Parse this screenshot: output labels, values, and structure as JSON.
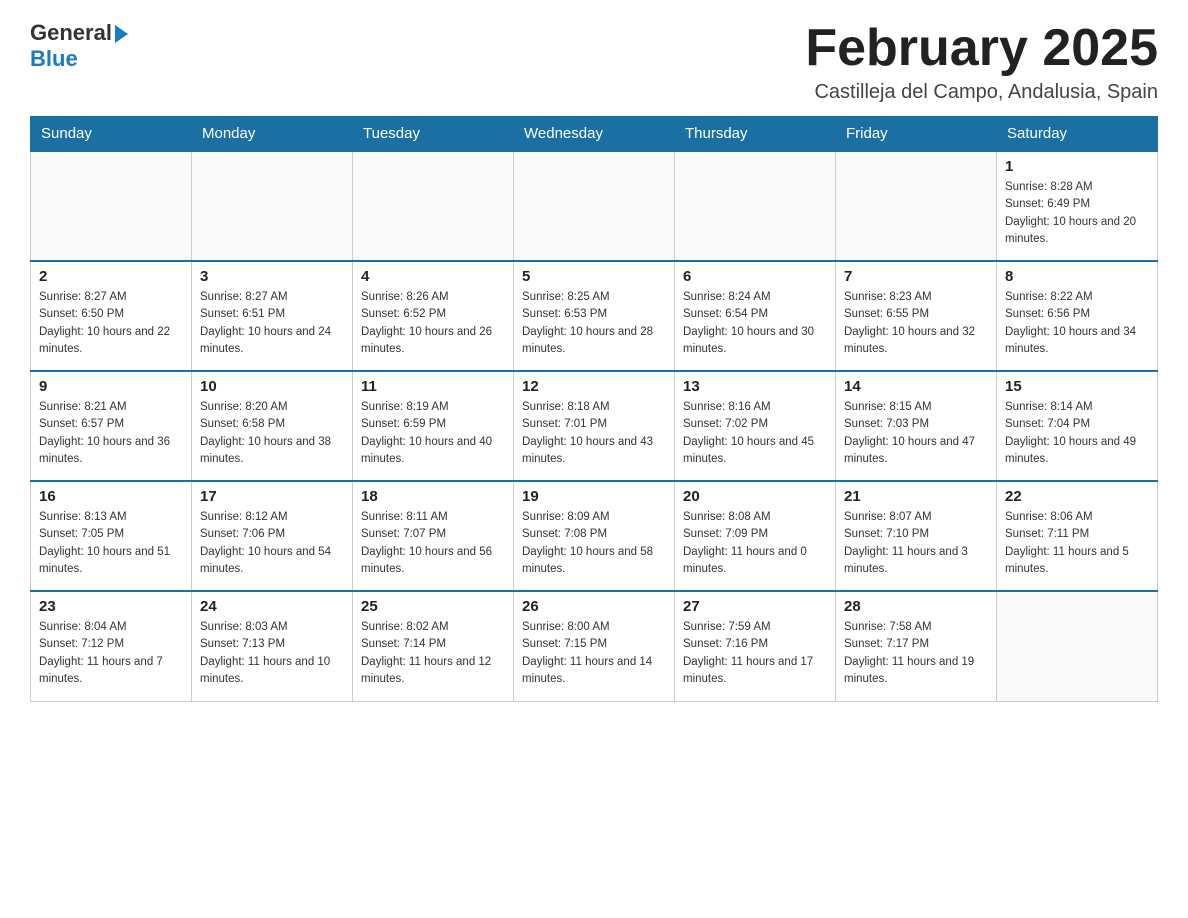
{
  "header": {
    "logo_general": "General",
    "logo_blue": "Blue",
    "month_title": "February 2025",
    "location": "Castilleja del Campo, Andalusia, Spain"
  },
  "days_of_week": [
    "Sunday",
    "Monday",
    "Tuesday",
    "Wednesday",
    "Thursday",
    "Friday",
    "Saturday"
  ],
  "weeks": [
    [
      {
        "day": "",
        "info": ""
      },
      {
        "day": "",
        "info": ""
      },
      {
        "day": "",
        "info": ""
      },
      {
        "day": "",
        "info": ""
      },
      {
        "day": "",
        "info": ""
      },
      {
        "day": "",
        "info": ""
      },
      {
        "day": "1",
        "info": "Sunrise: 8:28 AM\nSunset: 6:49 PM\nDaylight: 10 hours and 20 minutes."
      }
    ],
    [
      {
        "day": "2",
        "info": "Sunrise: 8:27 AM\nSunset: 6:50 PM\nDaylight: 10 hours and 22 minutes."
      },
      {
        "day": "3",
        "info": "Sunrise: 8:27 AM\nSunset: 6:51 PM\nDaylight: 10 hours and 24 minutes."
      },
      {
        "day": "4",
        "info": "Sunrise: 8:26 AM\nSunset: 6:52 PM\nDaylight: 10 hours and 26 minutes."
      },
      {
        "day": "5",
        "info": "Sunrise: 8:25 AM\nSunset: 6:53 PM\nDaylight: 10 hours and 28 minutes."
      },
      {
        "day": "6",
        "info": "Sunrise: 8:24 AM\nSunset: 6:54 PM\nDaylight: 10 hours and 30 minutes."
      },
      {
        "day": "7",
        "info": "Sunrise: 8:23 AM\nSunset: 6:55 PM\nDaylight: 10 hours and 32 minutes."
      },
      {
        "day": "8",
        "info": "Sunrise: 8:22 AM\nSunset: 6:56 PM\nDaylight: 10 hours and 34 minutes."
      }
    ],
    [
      {
        "day": "9",
        "info": "Sunrise: 8:21 AM\nSunset: 6:57 PM\nDaylight: 10 hours and 36 minutes."
      },
      {
        "day": "10",
        "info": "Sunrise: 8:20 AM\nSunset: 6:58 PM\nDaylight: 10 hours and 38 minutes."
      },
      {
        "day": "11",
        "info": "Sunrise: 8:19 AM\nSunset: 6:59 PM\nDaylight: 10 hours and 40 minutes."
      },
      {
        "day": "12",
        "info": "Sunrise: 8:18 AM\nSunset: 7:01 PM\nDaylight: 10 hours and 43 minutes."
      },
      {
        "day": "13",
        "info": "Sunrise: 8:16 AM\nSunset: 7:02 PM\nDaylight: 10 hours and 45 minutes."
      },
      {
        "day": "14",
        "info": "Sunrise: 8:15 AM\nSunset: 7:03 PM\nDaylight: 10 hours and 47 minutes."
      },
      {
        "day": "15",
        "info": "Sunrise: 8:14 AM\nSunset: 7:04 PM\nDaylight: 10 hours and 49 minutes."
      }
    ],
    [
      {
        "day": "16",
        "info": "Sunrise: 8:13 AM\nSunset: 7:05 PM\nDaylight: 10 hours and 51 minutes."
      },
      {
        "day": "17",
        "info": "Sunrise: 8:12 AM\nSunset: 7:06 PM\nDaylight: 10 hours and 54 minutes."
      },
      {
        "day": "18",
        "info": "Sunrise: 8:11 AM\nSunset: 7:07 PM\nDaylight: 10 hours and 56 minutes."
      },
      {
        "day": "19",
        "info": "Sunrise: 8:09 AM\nSunset: 7:08 PM\nDaylight: 10 hours and 58 minutes."
      },
      {
        "day": "20",
        "info": "Sunrise: 8:08 AM\nSunset: 7:09 PM\nDaylight: 11 hours and 0 minutes."
      },
      {
        "day": "21",
        "info": "Sunrise: 8:07 AM\nSunset: 7:10 PM\nDaylight: 11 hours and 3 minutes."
      },
      {
        "day": "22",
        "info": "Sunrise: 8:06 AM\nSunset: 7:11 PM\nDaylight: 11 hours and 5 minutes."
      }
    ],
    [
      {
        "day": "23",
        "info": "Sunrise: 8:04 AM\nSunset: 7:12 PM\nDaylight: 11 hours and 7 minutes."
      },
      {
        "day": "24",
        "info": "Sunrise: 8:03 AM\nSunset: 7:13 PM\nDaylight: 11 hours and 10 minutes."
      },
      {
        "day": "25",
        "info": "Sunrise: 8:02 AM\nSunset: 7:14 PM\nDaylight: 11 hours and 12 minutes."
      },
      {
        "day": "26",
        "info": "Sunrise: 8:00 AM\nSunset: 7:15 PM\nDaylight: 11 hours and 14 minutes."
      },
      {
        "day": "27",
        "info": "Sunrise: 7:59 AM\nSunset: 7:16 PM\nDaylight: 11 hours and 17 minutes."
      },
      {
        "day": "28",
        "info": "Sunrise: 7:58 AM\nSunset: 7:17 PM\nDaylight: 11 hours and 19 minutes."
      },
      {
        "day": "",
        "info": ""
      }
    ]
  ]
}
